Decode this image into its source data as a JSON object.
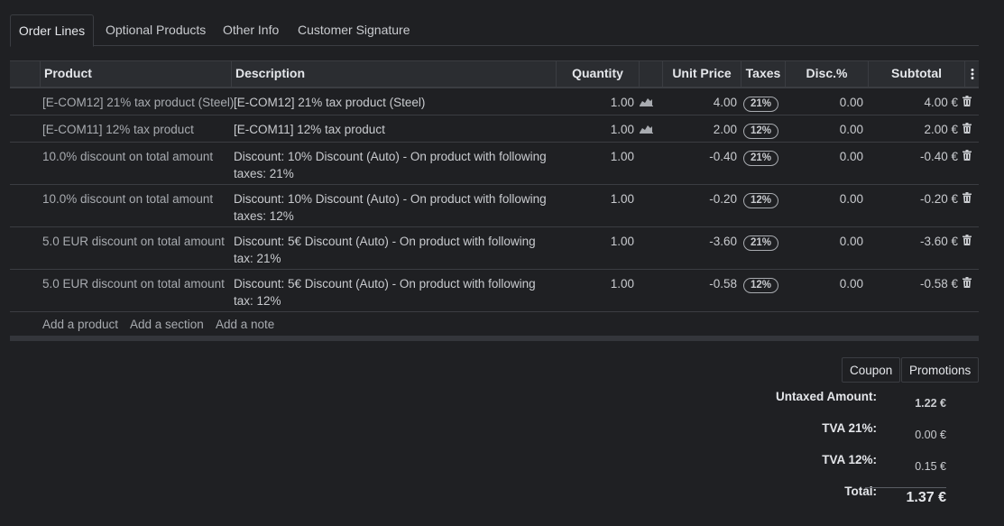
{
  "tabs": [
    "Order Lines",
    "Optional Products",
    "Other Info",
    "Customer Signature"
  ],
  "columns": {
    "product": "Product",
    "description": "Description",
    "quantity": "Quantity",
    "unit_price": "Unit Price",
    "taxes": "Taxes",
    "discount": "Disc.%",
    "subtotal": "Subtotal"
  },
  "lines": [
    {
      "product": "[E-COM12] 21% tax product (Steel)",
      "description": "[E-COM12] 21% tax product (Steel)",
      "quantity": "1.00",
      "forecast_icon": "area-chart-icon",
      "unit_price": "4.00",
      "tax": "21%",
      "discount": "0.00",
      "subtotal": "4.00 €"
    },
    {
      "product": "[E-COM11] 12% tax product",
      "description": "[E-COM11] 12% tax product",
      "quantity": "1.00",
      "forecast_icon": "area-chart-icon",
      "unit_price": "2.00",
      "tax": "12%",
      "discount": "0.00",
      "subtotal": "2.00 €"
    },
    {
      "product": "10.0% discount on total amount",
      "description": "Discount: 10% Discount (Auto) - On product with following taxes: 21%",
      "quantity": "1.00",
      "unit_price": "-0.40",
      "tax": "21%",
      "discount": "0.00",
      "subtotal": "-0.40 €"
    },
    {
      "product": "10.0% discount on total amount",
      "description": "Discount: 10% Discount (Auto) - On product with following taxes: 12%",
      "quantity": "1.00",
      "unit_price": "-0.20",
      "tax": "12%",
      "discount": "0.00",
      "subtotal": "-0.20 €"
    },
    {
      "product": "5.0 EUR discount on total amount",
      "description": "Discount: 5€ Discount (Auto) - On product with following tax: 21%",
      "quantity": "1.00",
      "unit_price": "-3.60",
      "tax": "21%",
      "discount": "0.00",
      "subtotal": "-3.60 €"
    },
    {
      "product": "5.0 EUR discount on total amount",
      "description": "Discount: 5€ Discount (Auto) - On product with following tax: 12%",
      "quantity": "1.00",
      "unit_price": "-0.58",
      "tax": "12%",
      "discount": "0.00",
      "subtotal": "-0.58 €"
    }
  ],
  "add_links": {
    "product": "Add a product",
    "section": "Add a section",
    "note": "Add a note"
  },
  "buttons": {
    "coupon": "Coupon",
    "promotions": "Promotions"
  },
  "totals": {
    "untaxed_label": "Untaxed Amount:",
    "untaxed_value": "1.22 €",
    "tva21_label": "TVA 21%:",
    "tva21_value": "0.00 €",
    "tva12_label": "TVA 12%:",
    "tva12_value": "0.15 €",
    "total_label": "Total:",
    "total_value": "1.37 €"
  },
  "icons": {
    "trash": "trash-icon",
    "column_options": "vertical-ellipsis-icon"
  }
}
